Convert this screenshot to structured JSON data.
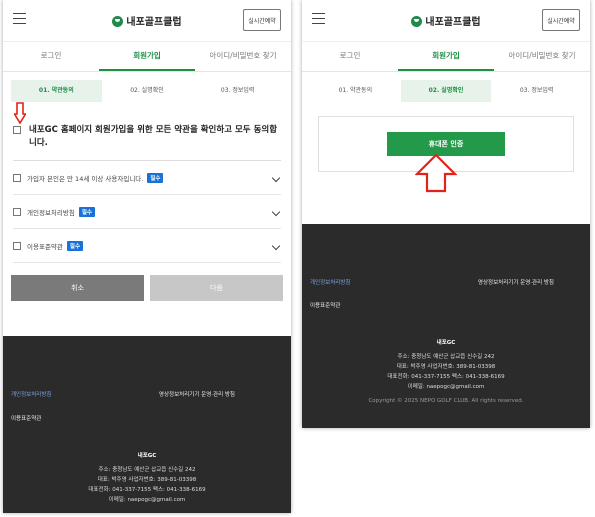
{
  "header": {
    "brand": "내포골프클럽",
    "realtime_button": "실시간예약",
    "brand_color": "#1f8a4c"
  },
  "tabs": [
    "로그인",
    "회원가입",
    "아이디/비밀번호 찾기"
  ],
  "steps": [
    "01. 약관동의",
    "02. 실명확인",
    "03. 정보입력"
  ],
  "agreement": {
    "all_label": "내포GC 홈페이지 회원가입을 위한 모든 약관을 확인하고 모두 동의합니다.",
    "items": [
      {
        "label": "가입자 본인은 만 14세 이상 사용자입니다.",
        "badge": "필수"
      },
      {
        "label": "개인정보처리방침",
        "badge": "필수"
      },
      {
        "label": "이용표준약관",
        "badge": "필수"
      }
    ],
    "cancel_label": "취소",
    "next_label": "다음"
  },
  "verification": {
    "button_label": "휴대폰 인증"
  },
  "footer": {
    "privacy_link": "개인정보처리방침",
    "cctv_link": "영상정보처리기기 운영·관리 방침",
    "terms_link": "이용표준약관",
    "company": "내포GC",
    "address": "주소: 충청남도 예산군 삽교읍 신수길 242",
    "ceo_biz": "대표: 박주영    사업자번호: 389-81-03398",
    "phone_fax": "대표전화: 041-337-7155    팩스: 041-338-6169",
    "email": "이메일: naepogc@gmail.com",
    "copyright": "Copyright © 2025 NEPO GOLF CLUB. All rights reserved."
  },
  "colors": {
    "accent_green": "#1e8f43",
    "required_badge": "#1a72d8",
    "annotation_red": "#e2231a"
  }
}
